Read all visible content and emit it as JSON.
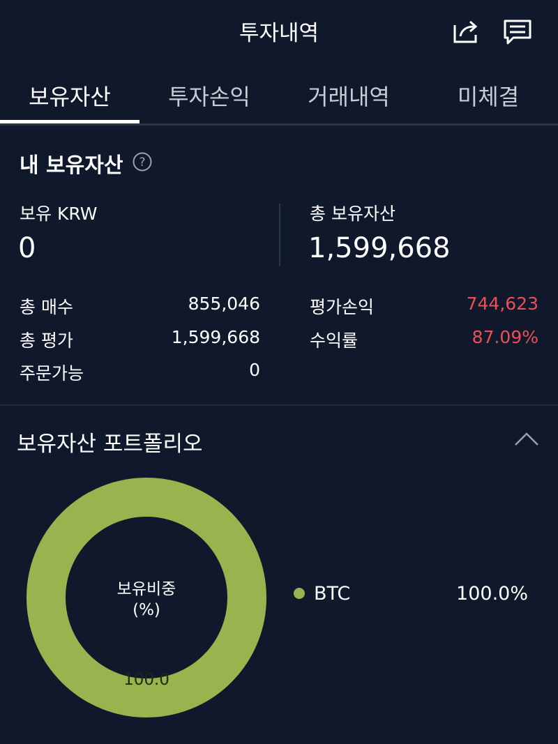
{
  "header": {
    "title": "투자내역",
    "share_icon": "share-icon",
    "chat_icon": "chat-icon"
  },
  "tabs": [
    {
      "label": "보유자산",
      "active": true
    },
    {
      "label": "투자손익",
      "active": false
    },
    {
      "label": "거래내역",
      "active": false
    },
    {
      "label": "미체결",
      "active": false
    }
  ],
  "assets": {
    "title": "내 보유자산",
    "help_icon": "help-icon",
    "krw_label": "보유 KRW",
    "krw_value": "0",
    "total_label": "총 보유자산",
    "total_value": "1,599,668",
    "rows_left": [
      {
        "label": "총 매수",
        "value": "855,046"
      },
      {
        "label": "총 평가",
        "value": "1,599,668"
      },
      {
        "label": "주문가능",
        "value": "0"
      }
    ],
    "rows_right": [
      {
        "label": "평가손익",
        "value": "744,623"
      },
      {
        "label": "수익률",
        "value": "87.09%"
      }
    ]
  },
  "portfolio": {
    "title": "보유자산 포트폴리오",
    "collapse_icon": "chevron-up-icon",
    "center_line1": "보유비중",
    "center_line2": "(%)",
    "slice_label": "100.0",
    "legend": [
      {
        "name": "BTC",
        "value": "100.0%",
        "color": "#99b34e"
      }
    ]
  },
  "colors": {
    "background": "#0f192b",
    "profit": "#ef4e55",
    "accent": "#99b34e"
  }
}
